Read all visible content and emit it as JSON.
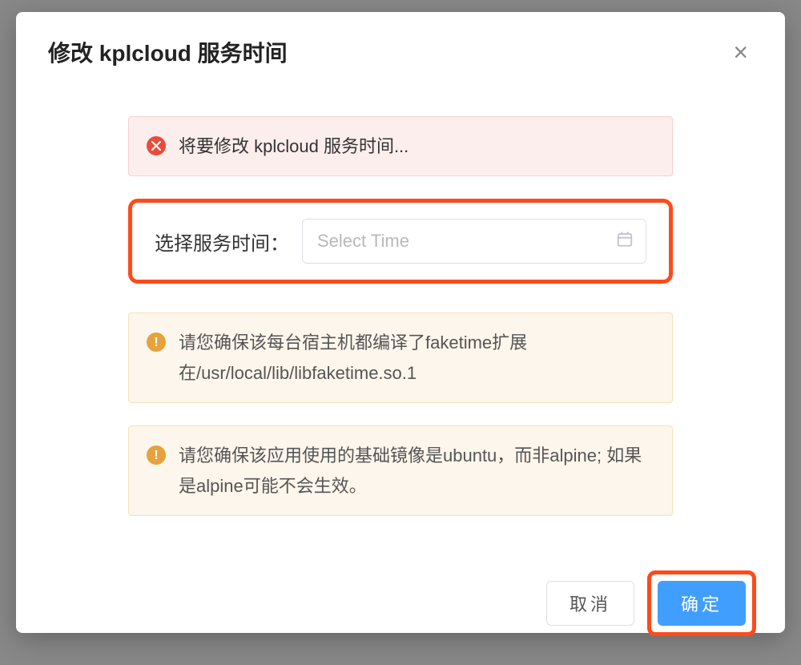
{
  "modal": {
    "title": "修改 kplcloud 服务时间",
    "close_label": "×"
  },
  "alert_error": {
    "text": "将要修改 kplcloud 服务时间..."
  },
  "time_field": {
    "label": "选择服务时间：",
    "placeholder": "Select Time"
  },
  "alert_warning_1": {
    "text": "请您确保该每台宿主机都编译了faketime扩展在/usr/local/lib/libfaketime.so.1"
  },
  "alert_warning_2": {
    "text": "请您确保该应用使用的基础镜像是ubuntu，而非alpine; 如果是alpine可能不会生效。"
  },
  "buttons": {
    "cancel": "取消",
    "confirm": "确定"
  }
}
